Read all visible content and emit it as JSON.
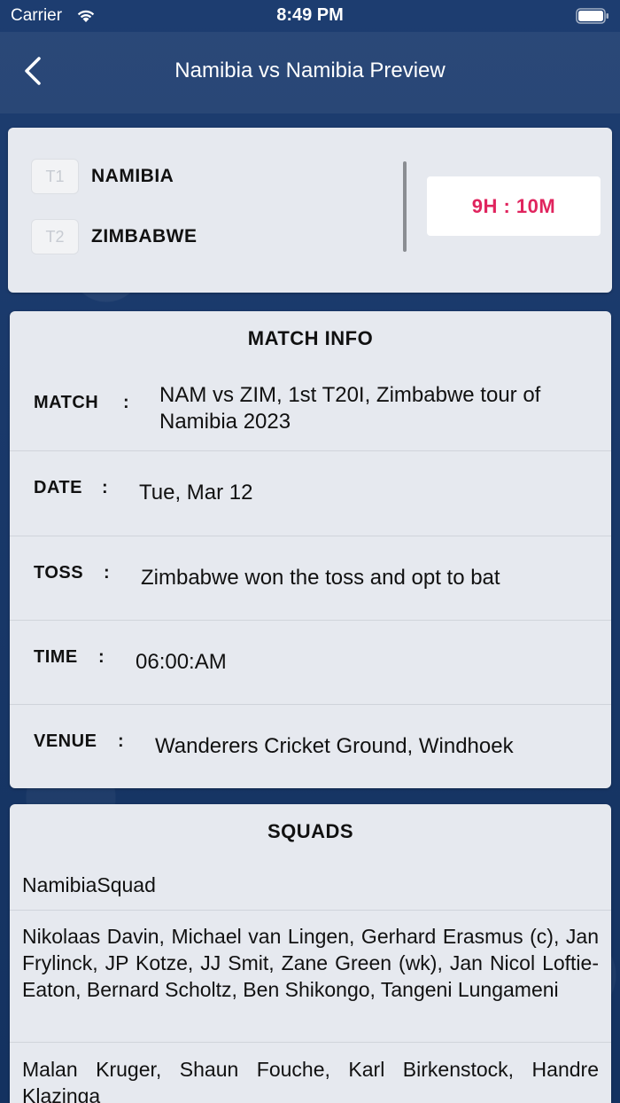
{
  "status_bar": {
    "carrier": "Carrier",
    "time": "8:49 PM"
  },
  "nav": {
    "title": "Namibia vs Namibia Preview"
  },
  "teams": {
    "team1": {
      "badge": "T1",
      "name": "NAMIBIA"
    },
    "team2": {
      "badge": "T2",
      "name": "ZIMBABWE"
    },
    "countdown": "9H : 10M"
  },
  "match_info": {
    "title": "MATCH INFO",
    "rows": [
      {
        "label": "MATCH",
        "colon": ":",
        "value": "NAM vs ZIM, 1st T20I, Zimbabwe tour of Namibia 2023"
      },
      {
        "label": "DATE",
        "colon": ":",
        "value": "Tue, Mar 12"
      },
      {
        "label": "TOSS",
        "colon": ":",
        "value": "Zimbabwe won the toss and opt to bat"
      },
      {
        "label": "TIME",
        "colon": ":",
        "value": "06:00:AM"
      },
      {
        "label": "VENUE",
        "colon": ":",
        "value": "Wanderers Cricket Ground, Windhoek"
      }
    ]
  },
  "squads": {
    "title": "SQUADS",
    "team1_heading": "NamibiaSquad",
    "team1_players": "Nikolaas Davin, Michael van Lingen, Gerhard Erasmus (c), Jan Frylinck, JP Kotze, JJ Smit, Zane Green (wk), Jan Nicol Loftie-Eaton, Bernard Scholtz, Ben Shikongo, Tangeni Lungameni",
    "team2_players": "Malan Kruger, Shaun Fouche, Karl Birkenstock, Handre Klazinga"
  },
  "colors": {
    "accent": "#e0245e",
    "background": "#14315e",
    "card": "#e6e9ef"
  }
}
